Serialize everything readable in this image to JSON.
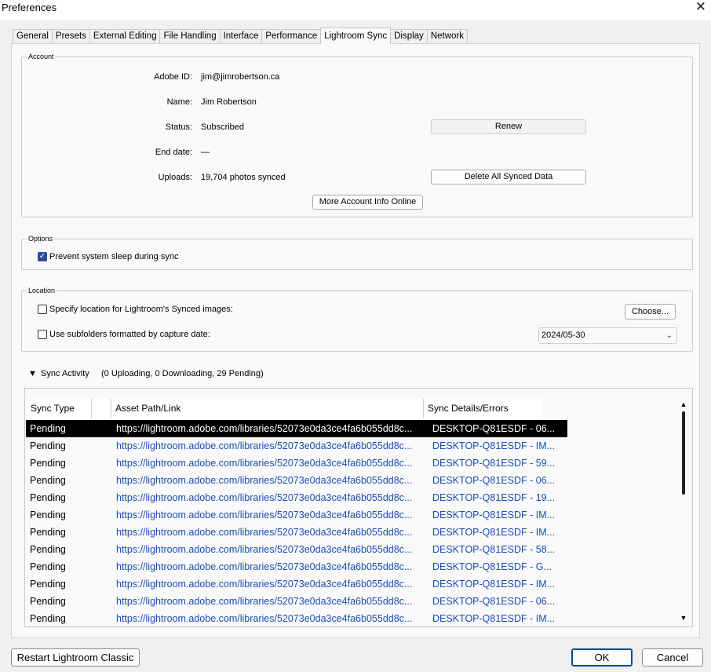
{
  "window": {
    "title": "Preferences",
    "close_glyph": "✕"
  },
  "tabs": [
    {
      "label": "General"
    },
    {
      "label": "Presets"
    },
    {
      "label": "External Editing"
    },
    {
      "label": "File Handling"
    },
    {
      "label": "Interface"
    },
    {
      "label": "Performance"
    },
    {
      "label": "Lightroom Sync",
      "active": true
    },
    {
      "label": "Display"
    },
    {
      "label": "Network"
    }
  ],
  "account": {
    "title": "Account",
    "adobe_id_label": "Adobe ID:",
    "adobe_id": "jim@jimrobertson.ca",
    "name_label": "Name:",
    "name": "Jim Robertson",
    "status_label": "Status:",
    "status": "Subscribed",
    "end_date_label": "End date:",
    "end_date": "—",
    "uploads_label": "Uploads:",
    "uploads": "19,704 photos synced",
    "renew_label": "Renew",
    "delete_label": "Delete All Synced Data",
    "more_info_label": "More Account Info Online"
  },
  "options": {
    "title": "Options",
    "prevent_sleep_label": "Prevent system sleep during sync",
    "prevent_sleep_checked": true
  },
  "location": {
    "title": "Location",
    "specify_label": "Specify location for Lightroom's Synced images:",
    "specify_checked": false,
    "choose_label": "Choose...",
    "subfolders_label": "Use subfolders formatted by capture date:",
    "subfolders_checked": false,
    "date_format": "2024/05-30"
  },
  "sync_activity": {
    "label": "Sync Activity",
    "summary": "(0 Uploading, 0 Downloading, 29 Pending)",
    "columns": [
      "Sync Type",
      "",
      "Asset Path/Link",
      "Sync Details/Errors"
    ],
    "rows": [
      {
        "type": "Pending",
        "path": "https://lightroom.adobe.com/libraries/52073e0da3ce4fa6b055dd8c...",
        "details": "DESKTOP-Q81ESDF  - 06...",
        "selected": true
      },
      {
        "type": "Pending",
        "path": "https://lightroom.adobe.com/libraries/52073e0da3ce4fa6b055dd8c...",
        "details": "DESKTOP-Q81ESDF  - IM..."
      },
      {
        "type": "Pending",
        "path": "https://lightroom.adobe.com/libraries/52073e0da3ce4fa6b055dd8c...",
        "details": "DESKTOP-Q81ESDF  - 59..."
      },
      {
        "type": "Pending",
        "path": "https://lightroom.adobe.com/libraries/52073e0da3ce4fa6b055dd8c...",
        "details": "DESKTOP-Q81ESDF  - 06..."
      },
      {
        "type": "Pending",
        "path": "https://lightroom.adobe.com/libraries/52073e0da3ce4fa6b055dd8c...",
        "details": "DESKTOP-Q81ESDF  - 19..."
      },
      {
        "type": "Pending",
        "path": "https://lightroom.adobe.com/libraries/52073e0da3ce4fa6b055dd8c...",
        "details": "DESKTOP-Q81ESDF  - IM..."
      },
      {
        "type": "Pending",
        "path": "https://lightroom.adobe.com/libraries/52073e0da3ce4fa6b055dd8c...",
        "details": "DESKTOP-Q81ESDF  - IM..."
      },
      {
        "type": "Pending",
        "path": "https://lightroom.adobe.com/libraries/52073e0da3ce4fa6b055dd8c...",
        "details": "DESKTOP-Q81ESDF  - 58..."
      },
      {
        "type": "Pending",
        "path": "https://lightroom.adobe.com/libraries/52073e0da3ce4fa6b055dd8c...",
        "details": "DESKTOP-Q81ESDF  - G..."
      },
      {
        "type": "Pending",
        "path": "https://lightroom.adobe.com/libraries/52073e0da3ce4fa6b055dd8c...",
        "details": "DESKTOP-Q81ESDF  - IM..."
      },
      {
        "type": "Pending",
        "path": "https://lightroom.adobe.com/libraries/52073e0da3ce4fa6b055dd8c...",
        "details": "DESKTOP-Q81ESDF  - 06..."
      },
      {
        "type": "Pending",
        "path": "https://lightroom.adobe.com/libraries/52073e0da3ce4fa6b055dd8c...",
        "details": "DESKTOP-Q81ESDF  - IM..."
      }
    ]
  },
  "footer": {
    "restart_label": "Restart Lightroom Classic",
    "ok_label": "OK",
    "cancel_label": "Cancel"
  },
  "colors": {
    "link": "#1a4db3",
    "check_accent": "#2b4e9e",
    "primary_border": "#0b4a8f"
  }
}
